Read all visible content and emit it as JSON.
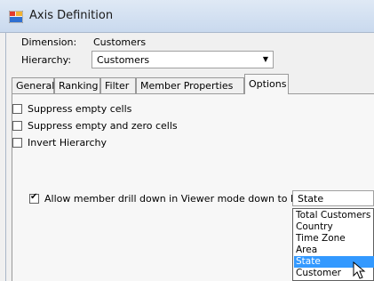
{
  "window": {
    "title": "Axis Definition",
    "icon": "app-window-icon"
  },
  "form": {
    "dimension_label": "Dimension:",
    "dimension_value": "Customers",
    "hierarchy_label": "Hierarchy:",
    "hierarchy_value": "Customers"
  },
  "tabs": [
    {
      "label": "General"
    },
    {
      "label": "Ranking"
    },
    {
      "label": "Filter"
    },
    {
      "label": "Member Properties"
    },
    {
      "label": "Options"
    }
  ],
  "active_tab": "Options",
  "options": {
    "suppress_empty": {
      "label": "Suppress empty cells",
      "checked": false
    },
    "suppress_empty_zero": {
      "label": "Suppress empty and zero cells",
      "checked": false
    },
    "invert_hierarchy": {
      "label": "Invert Hierarchy",
      "checked": false
    },
    "allow_drilldown": {
      "label": "Allow member drill down in Viewer mode down to level",
      "checked": true
    }
  },
  "level_select": {
    "value": "State",
    "options": [
      "Total Customers",
      "Country",
      "Time Zone",
      "Area",
      "State",
      "Customer"
    ],
    "highlighted": "State"
  },
  "colors": {
    "selection": "#3399ff",
    "titlebar": "#c9d9ee"
  }
}
